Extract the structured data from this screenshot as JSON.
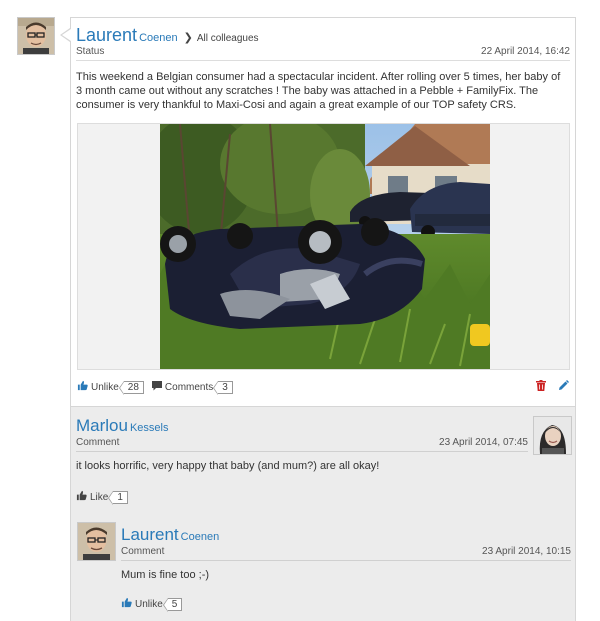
{
  "post": {
    "author_first": "Laurent",
    "author_last": "Coenen",
    "audience": "All colleagues",
    "type": "Status",
    "timestamp": "22 April 2014, 16:42",
    "text": "This weekend a Belgian consumer had a spectacular incident. After rolling over 5 times, her baby of 3 month came out without any scratches ! The baby was attached in a Pebble + FamilyFix. The consumer is very thankful to Maxi-Cosi and again a great example of our TOP safety CRS.",
    "actions": {
      "unlike_label": "Unlike",
      "unlike_count": "28",
      "comments_label": "Comments",
      "comments_count": "3"
    }
  },
  "comments": [
    {
      "author_first": "Marlou",
      "author_last": "Kessels",
      "type": "Comment",
      "timestamp": "23 April 2014, 07:45",
      "text": "it looks horrific, very happy that baby (and mum?) are all okay!",
      "like_label": "Like",
      "like_count": "1"
    },
    {
      "author_first": "Laurent",
      "author_last": "Coenen",
      "type": "Comment",
      "timestamp": "23 April 2014, 10:15",
      "text": "Mum is fine too ;-)",
      "like_label": "Unlike",
      "like_count": "5"
    }
  ],
  "colors": {
    "accent": "#2a7ab8",
    "delete": "#cc2222",
    "comment_bg": "#ececec"
  },
  "icons": [
    "thumbs-up-icon",
    "speech-bubble-icon",
    "trash-icon",
    "pencil-icon"
  ]
}
